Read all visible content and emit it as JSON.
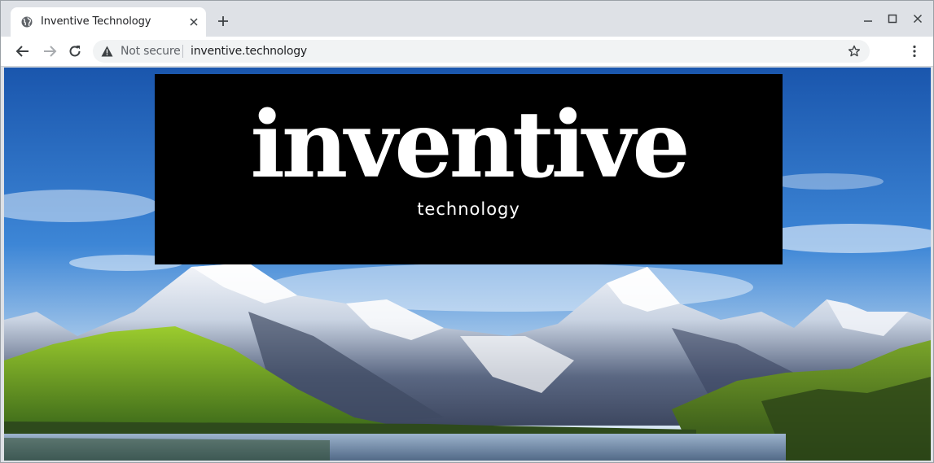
{
  "browser": {
    "tab_title": "Inventive Technology",
    "security_label": "Not secure",
    "url": "inventive.technology",
    "icons": {
      "favicon": "globe-icon",
      "tab_close": "close-icon",
      "new_tab": "plus-icon",
      "minimize": "minimize-icon",
      "maximize": "maximize-icon",
      "close_window": "close-icon",
      "back": "back-arrow-icon",
      "forward": "forward-arrow-icon",
      "reload": "reload-icon",
      "warning": "warning-icon",
      "bookmark": "star-icon",
      "menu": "kebab-menu-icon"
    }
  },
  "page": {
    "logo_word": "inventive",
    "logo_sub": "technology",
    "background": "mountain-lake-landscape"
  },
  "colors": {
    "logo_bg": "#000000",
    "logo_text": "#ffffff",
    "tabstrip_bg": "#dee1e6",
    "omnibox_bg": "#f1f3f4"
  }
}
